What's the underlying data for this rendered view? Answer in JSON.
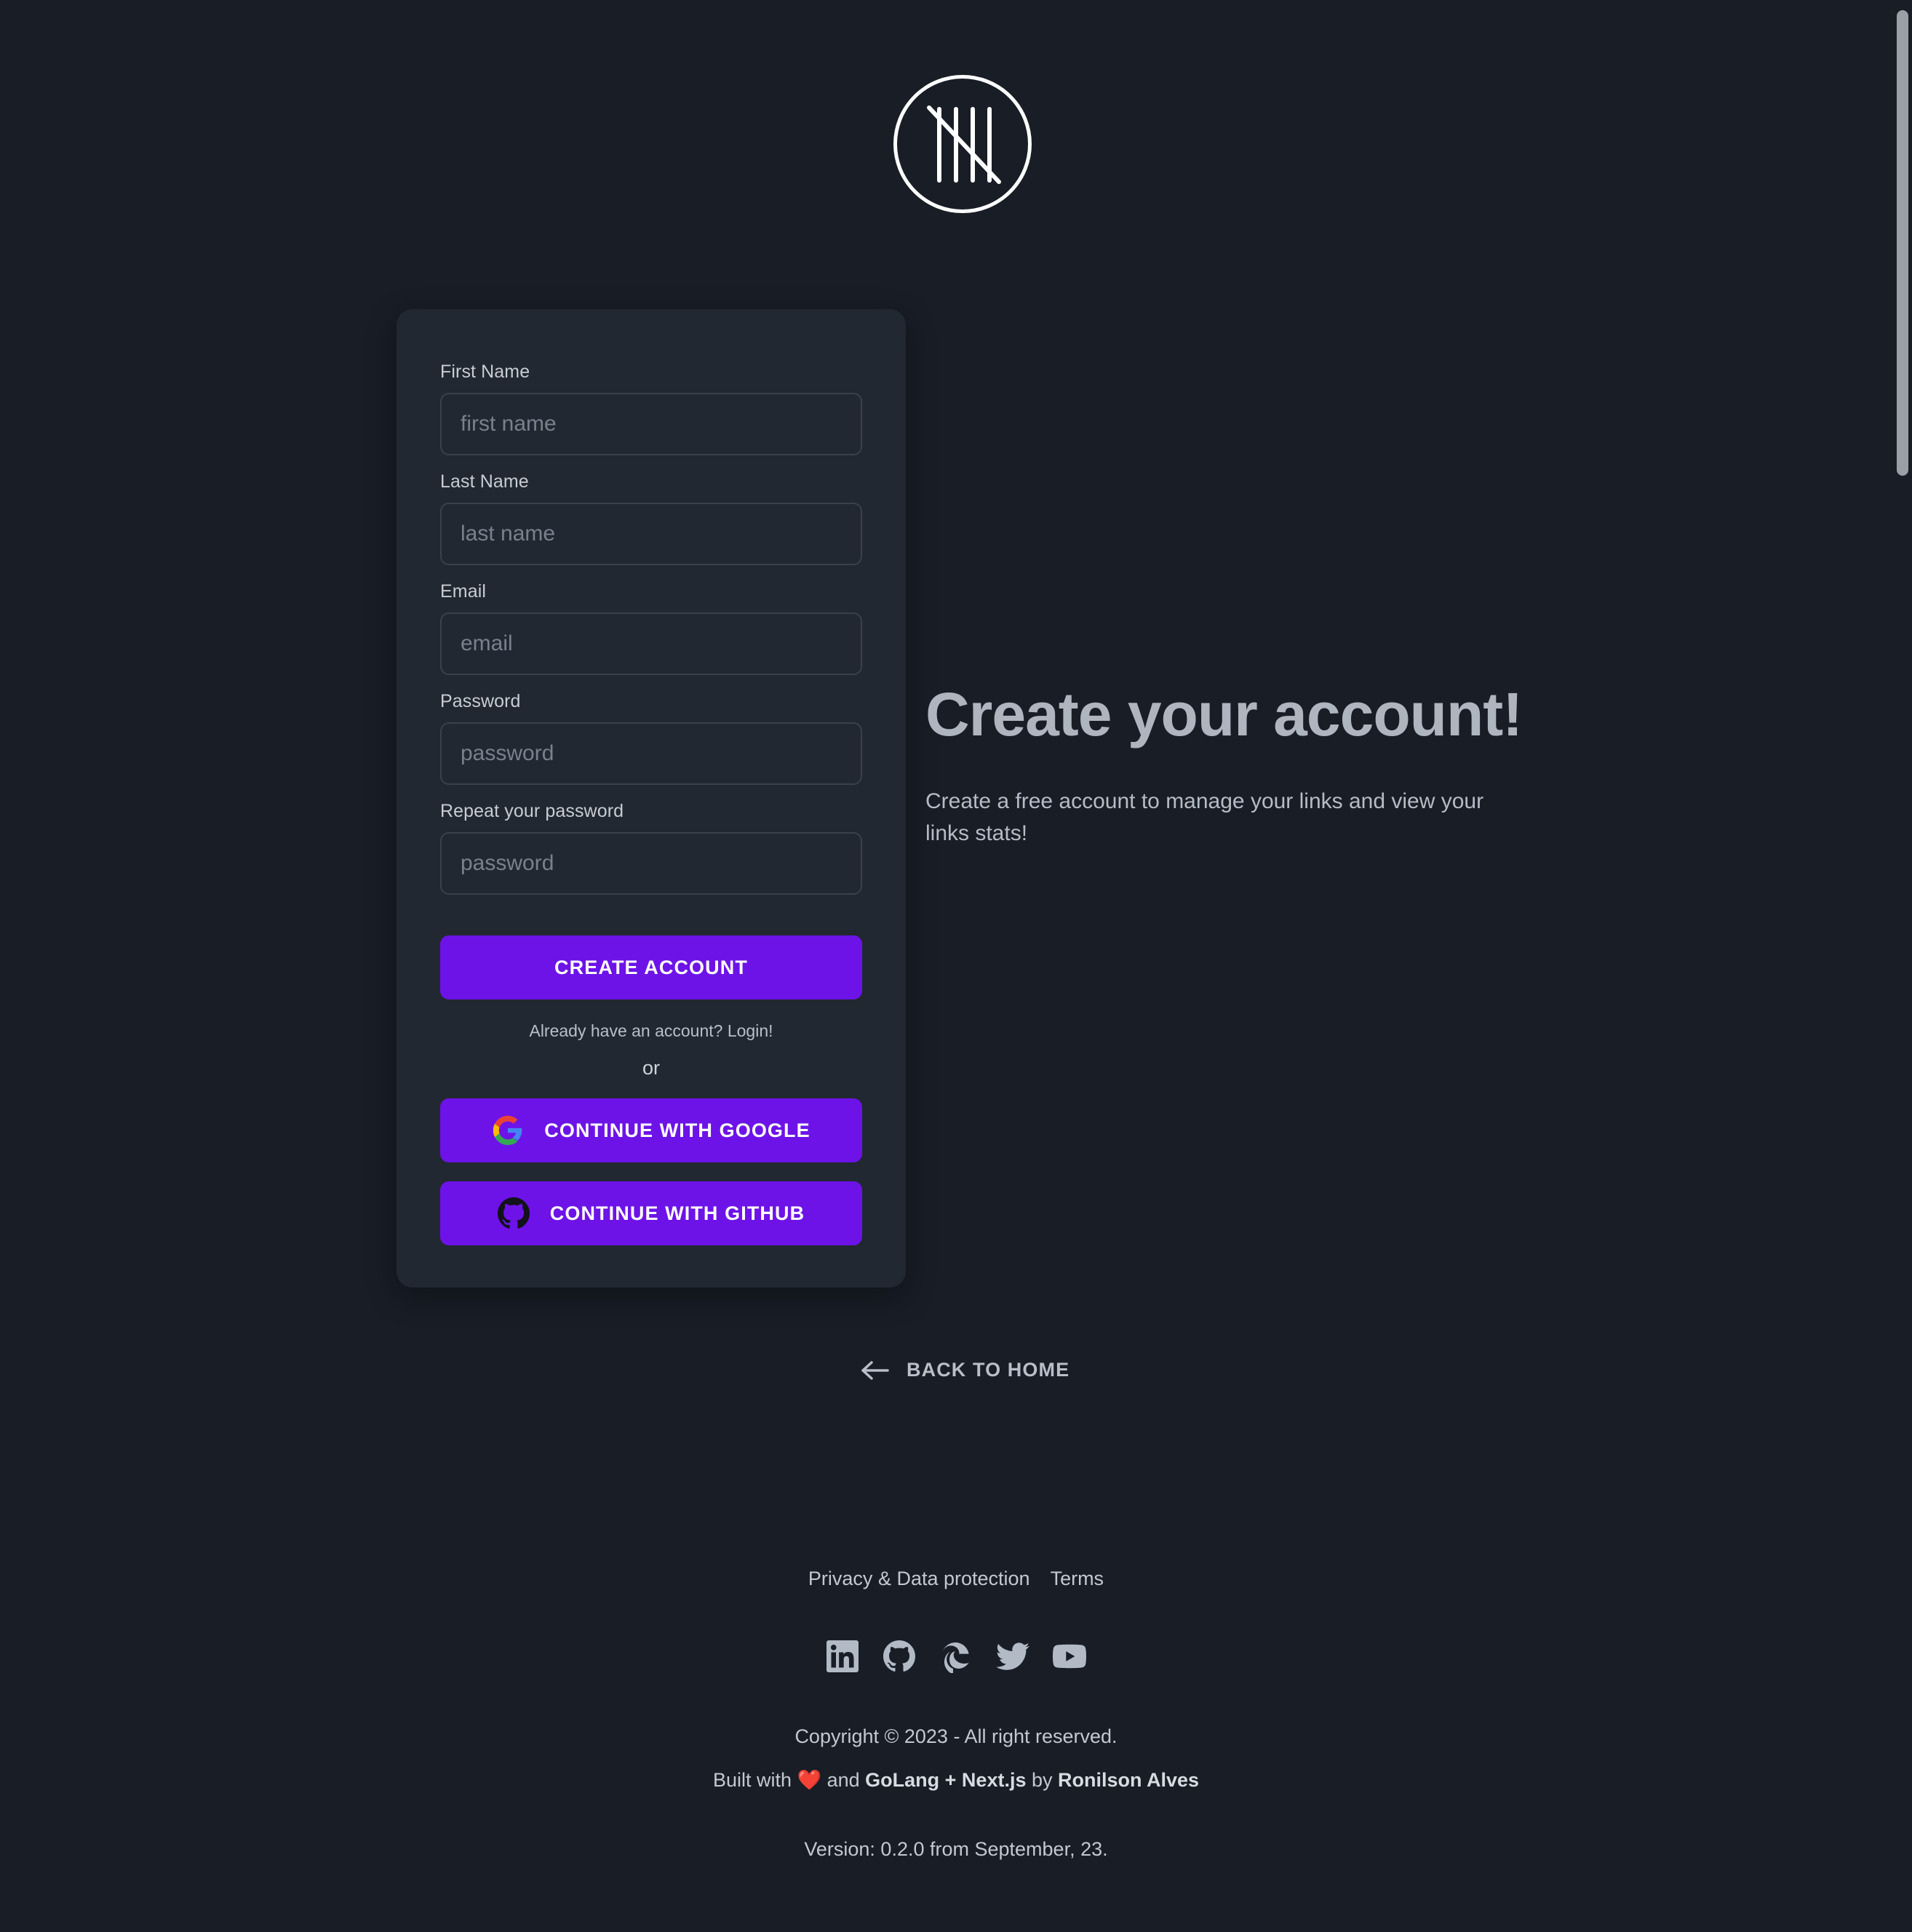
{
  "theme": {
    "page_bg": "#181d26",
    "card_bg": "#222831",
    "accent_purple": "#6d13e8",
    "text_muted": "#b9bfc8",
    "heart_red": "#ff3b30"
  },
  "logo": {
    "name": "tally-mark-logo"
  },
  "form": {
    "fields": [
      {
        "label": "First Name",
        "placeholder": "first name",
        "value": "",
        "type": "text",
        "name": "first-name"
      },
      {
        "label": "Last Name",
        "placeholder": "last name",
        "value": "",
        "type": "text",
        "name": "last-name"
      },
      {
        "label": "Email",
        "placeholder": "email",
        "value": "",
        "type": "email",
        "name": "email"
      },
      {
        "label": "Password",
        "placeholder": "password",
        "value": "",
        "type": "password",
        "name": "password"
      },
      {
        "label": "Repeat your password",
        "placeholder": "password",
        "value": "",
        "type": "password",
        "name": "repeat-password"
      }
    ],
    "submit_label": "CREATE ACCOUNT",
    "login_prompt": "Already have an account? Login!",
    "or_label": "or",
    "google_label": "CONTINUE WITH GOOGLE",
    "github_label": "CONTINUE WITH GITHUB"
  },
  "hero": {
    "title": "Create your account!",
    "subtitle": "Create a free account to manage your links and view your links stats!"
  },
  "back_home": {
    "label": "BACK TO HOME",
    "icon": "arrow-left-icon"
  },
  "footer": {
    "links": [
      {
        "label": "Privacy & Data protection"
      },
      {
        "label": "Terms"
      }
    ],
    "socials": [
      {
        "name": "linkedin-icon"
      },
      {
        "name": "github-icon"
      },
      {
        "name": "edge-icon"
      },
      {
        "name": "twitter-icon"
      },
      {
        "name": "youtube-icon"
      }
    ],
    "copyright": "Copyright © 2023 - All right reserved.",
    "built_prefix": "Built with ",
    "built_heart": "❤️",
    "built_middle": " and ",
    "built_stack": "GoLang + Next.js",
    "built_by": " by ",
    "built_author": "Ronilson Alves",
    "version": "Version: 0.2.0 from September, 23."
  }
}
